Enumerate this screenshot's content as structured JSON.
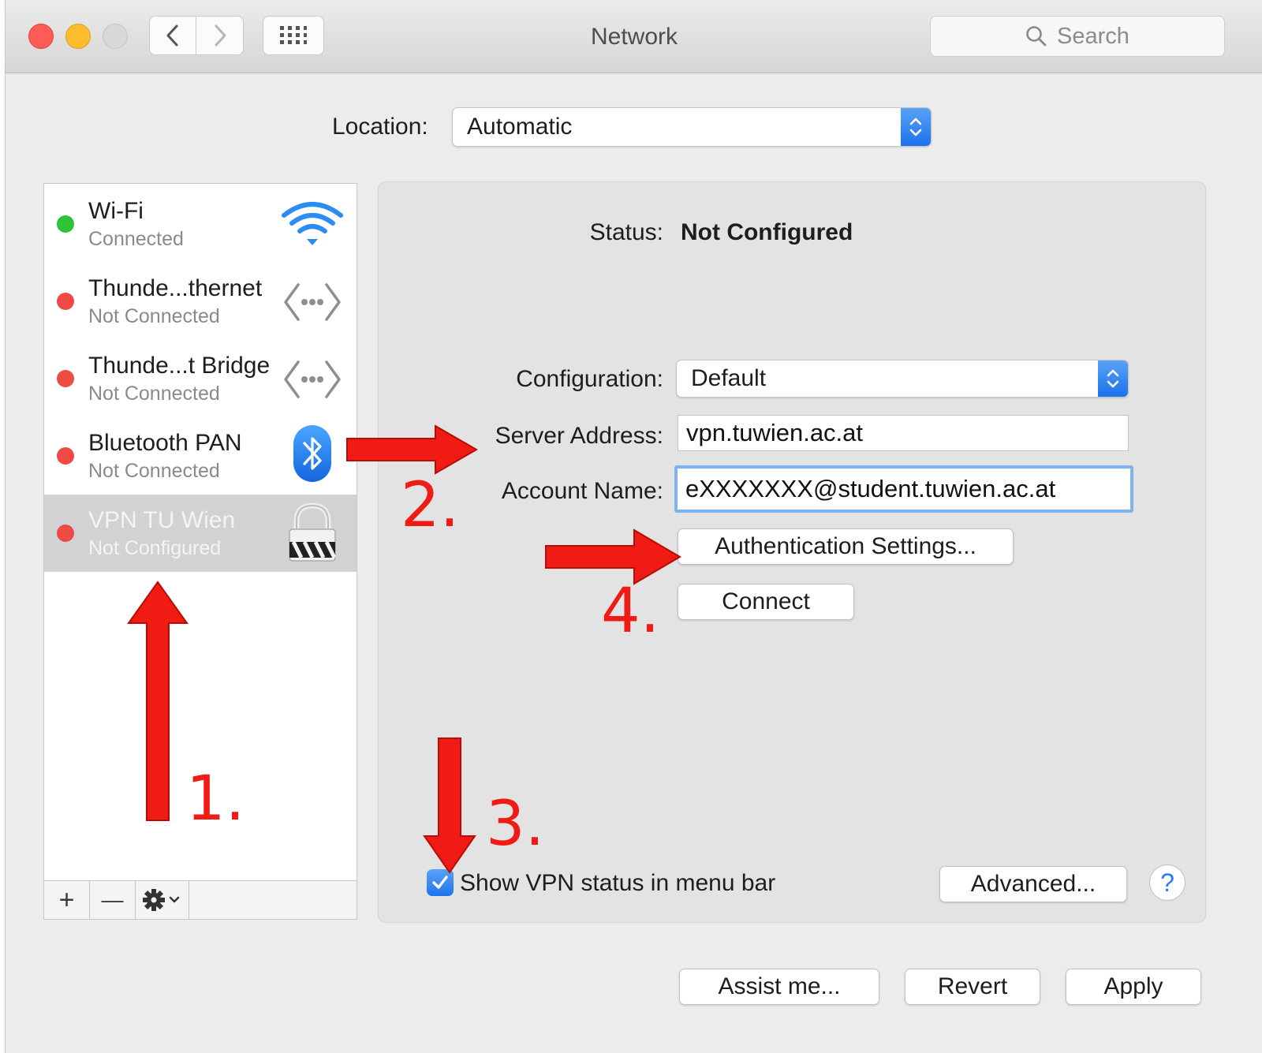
{
  "window": {
    "title": "Network"
  },
  "toolbar": {
    "search_placeholder": "Search"
  },
  "location": {
    "label": "Location:",
    "value": "Automatic"
  },
  "services": [
    {
      "name": "Wi-Fi",
      "status": "Connected",
      "status_color": "#2dc43a",
      "icon": "wifi-icon"
    },
    {
      "name": "Thunde...thernet",
      "status": "Not Connected",
      "status_color": "#f04a45",
      "icon": "ethernet-icon"
    },
    {
      "name": "Thunde...t Bridge",
      "status": "Not Connected",
      "status_color": "#f04a45",
      "icon": "ethernet-icon"
    },
    {
      "name": "Bluetooth PAN",
      "status": "Not Connected",
      "status_color": "#f04a45",
      "icon": "bluetooth-icon"
    },
    {
      "name": "VPN TU Wien",
      "status": "Not Configured",
      "status_color": "#f04a45",
      "icon": "vpn-lock-icon",
      "selected": true
    }
  ],
  "sidebar_buttons": {
    "add": "+",
    "remove": "—"
  },
  "detail": {
    "status_label": "Status:",
    "status_value": "Not Configured",
    "configuration_label": "Configuration:",
    "configuration_value": "Default",
    "server_label": "Server Address:",
    "server_value": "vpn.tuwien.ac.at",
    "account_label": "Account Name:",
    "account_value": "eXXXXXXX@student.tuwien.ac.at",
    "auth_button": "Authentication Settings...",
    "connect_button": "Connect",
    "show_vpn_status": "Show VPN status in menu bar",
    "show_vpn_checked": true,
    "advanced_button": "Advanced...",
    "help_button": "?"
  },
  "footer": {
    "assist": "Assist me...",
    "revert": "Revert",
    "apply": "Apply"
  },
  "annotations": {
    "step1": "1.",
    "step2": "2.",
    "step3": "3.",
    "step4": "4.",
    "color": "#ef1b14"
  },
  "colors": {
    "accent": "#1f74ec",
    "selection": "#d2d2d2"
  }
}
